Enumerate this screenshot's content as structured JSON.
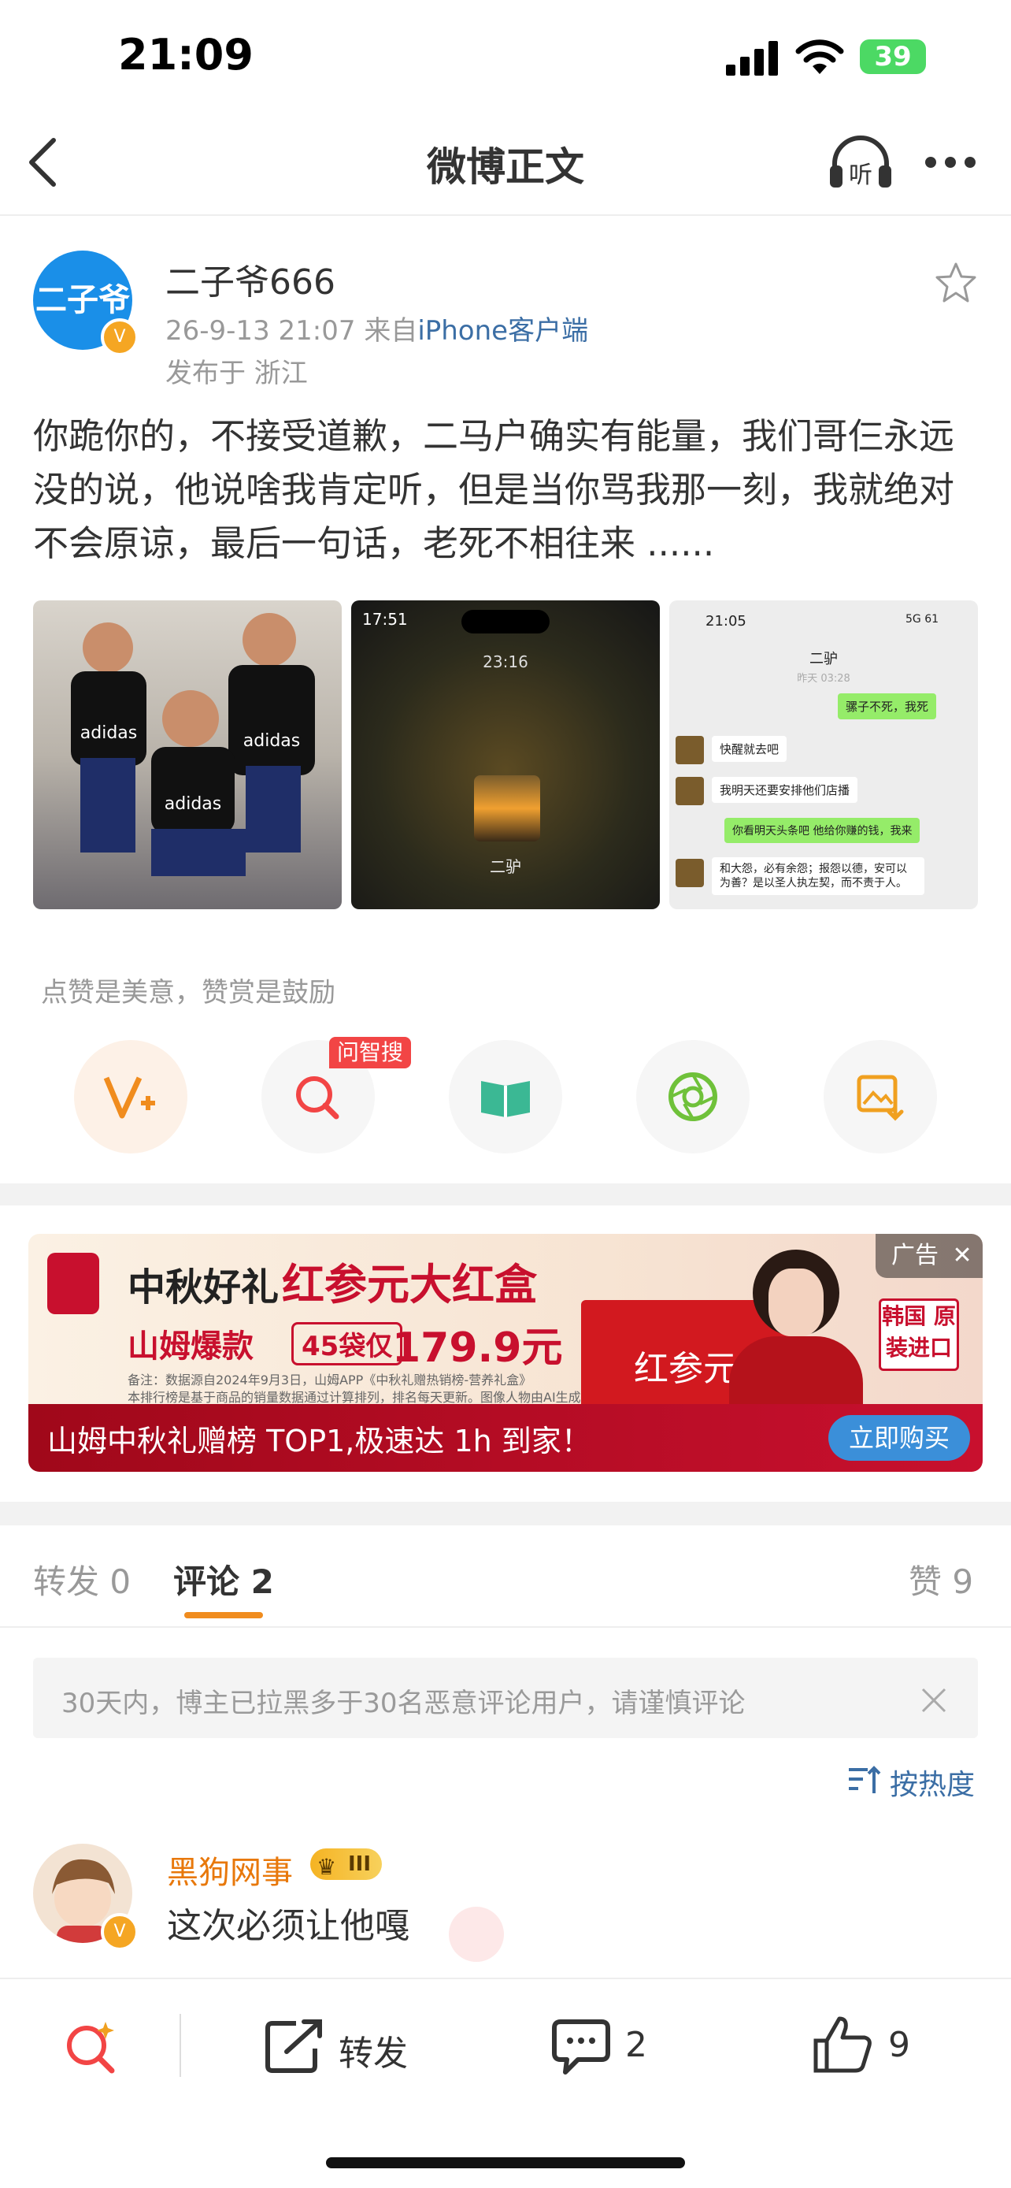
{
  "status_bar": {
    "time": "21:09",
    "battery": "39"
  },
  "nav": {
    "title": "微博正文"
  },
  "post": {
    "username": "二子爷666",
    "avatar_text": "二子爷",
    "date": "26-9-13 21:07",
    "source_prefix": "来自",
    "source": "iPhone客户端",
    "location": "发布于 浙江",
    "text": "你跪你的，不接受道歉，二马户确实有能量，我们哥仨永远没的说，他说啥我肯定听，但是当你骂我那一刻，我就绝对不会原谅，最后一句话，老死不相往来 ......",
    "photo2": {
      "time": "17:51",
      "duration": "23:16",
      "caption": "二驴"
    },
    "photo3": {
      "time": "21:05",
      "net": "5G",
      "battery": "61",
      "title": "二驴",
      "date": "昨天 03:28",
      "messages": [
        "骡子不死，我死",
        "快醒就去吧",
        "我明天还要安排他们店播",
        "你看明天头条吧 他给你赚的钱，我来",
        "和大怨，必有余怨；报怨以德，安可以为善？是以圣人执左契，而不责于人。"
      ]
    }
  },
  "actions": {
    "hint": "点赞是美意，赞赏是鼓励",
    "ai_badge": "问智搜"
  },
  "ad": {
    "label": "广告",
    "headline_a": "中秋好礼",
    "headline_b": "红参元大红盒",
    "hot": "山姆爆款",
    "pack": "45袋仅",
    "price": "179.9元",
    "fineprint_1": "备注：数据源自2024年9月3日，山姆APP《中秋礼赠热销榜-营养礼盒》",
    "fineprint_2": "本排行榜是基于商品的销量数据通过计算排列，排名每天更新。图像人物由AI生成",
    "brand_badge": "韩国 原装进口",
    "box_text": "红参元",
    "banner": "山姆中秋礼赠榜 TOP1,极速达 1h 到家！",
    "cta": "立即购买"
  },
  "tabs": {
    "repost": "转发 0",
    "comments": "评论 2",
    "likes": "赞 9"
  },
  "notice": "30天内，博主已拉黑多于30名恶意评论用户，请谨慎评论",
  "sort": "按热度",
  "comment": {
    "user": "黑狗网事",
    "level": "III",
    "text": "这次必须让他嘎"
  },
  "bottom_bar": {
    "repost": "转发",
    "comments": "2",
    "likes": "9"
  },
  "colors": {
    "brand_orange": "#f08c1e",
    "link_blue": "#3b6ea5",
    "ad_red": "#c8102e"
  }
}
